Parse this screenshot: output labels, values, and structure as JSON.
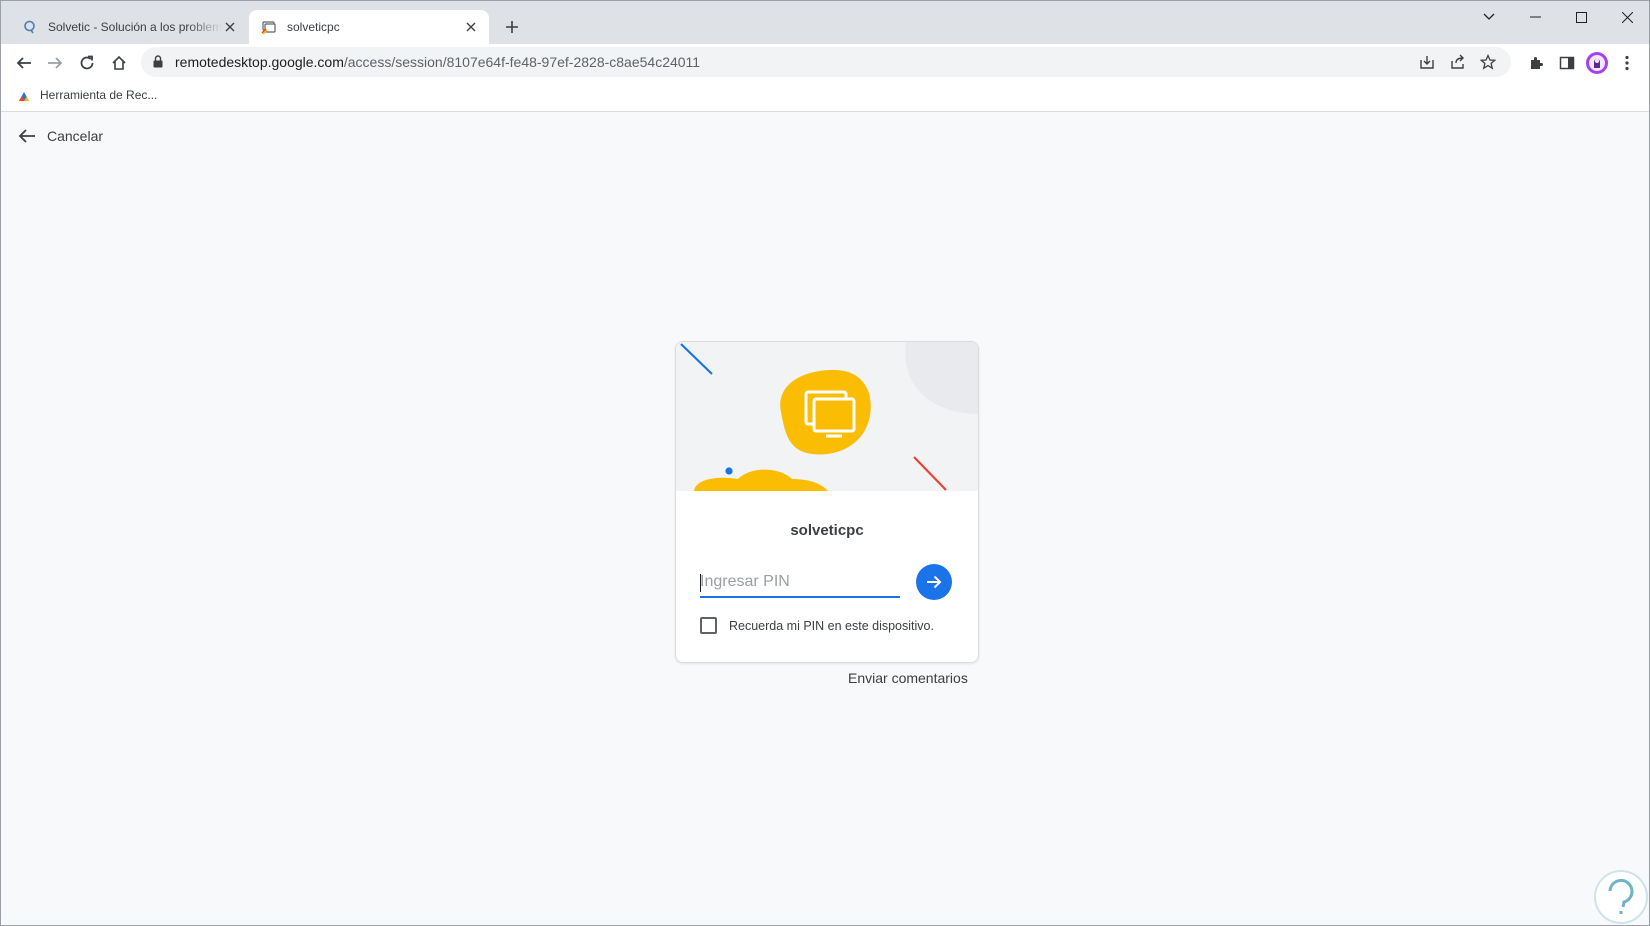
{
  "browser": {
    "tabs": [
      {
        "title": "Solvetic - Solución a los problemas",
        "favicon": "solvetic-icon",
        "active": false
      },
      {
        "title": "solveticpc",
        "favicon": "remote-desktop-icon",
        "active": true
      }
    ],
    "url": {
      "host": "remotedesktop.google.com",
      "path": "/access/session/8107e64f-fe48-97ef-2828-c8ae54c24011"
    },
    "bookmarks": [
      {
        "label": "Herramienta de Rec..."
      }
    ]
  },
  "page": {
    "cancel_label": "Cancelar",
    "host_name": "solveticpc",
    "pin_placeholder": "Ingresar PIN",
    "remember_label": "Recuerda mi PIN en este dispositivo.",
    "feedback_label": "Enviar comentarios"
  },
  "colors": {
    "accent": "#1a73e8",
    "art_yellow": "#fbbc04",
    "art_red": "#ea4335",
    "art_blue": "#1a73e8"
  }
}
